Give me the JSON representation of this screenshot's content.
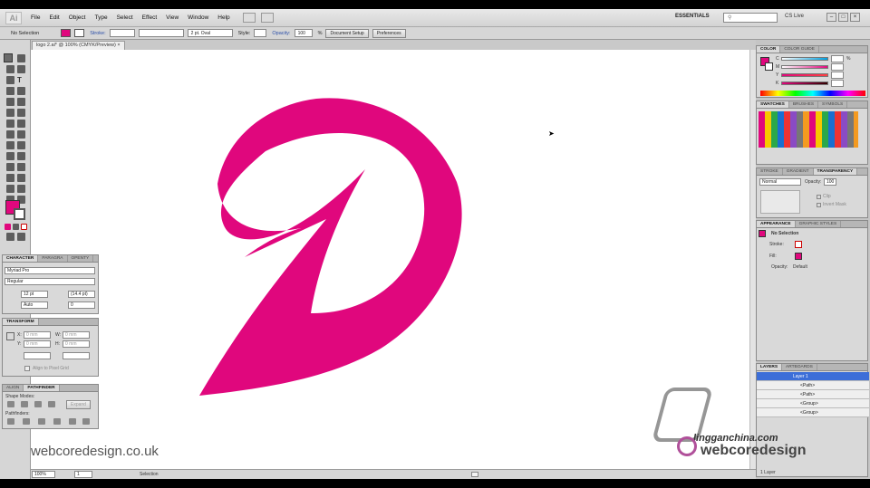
{
  "menubar": {
    "logo": "Ai",
    "items": [
      "File",
      "Edit",
      "Object",
      "Type",
      "Select",
      "Effect",
      "View",
      "Window",
      "Help"
    ],
    "workspace": "ESSENTIALS",
    "cs_live": "CS Live"
  },
  "controlbar": {
    "selection": "No Selection",
    "stroke_label": "Stroke:",
    "brush": "2 pt. Oval",
    "style_label": "Style:",
    "opacity_label": "Opacity:",
    "opacity_value": "100",
    "percent": "%",
    "document_setup": "Document Setup",
    "preferences": "Preferences",
    "fill_color": "#e0077d"
  },
  "document": {
    "tab_title": "logo 2.ai* @ 100% (CMYK/Preview)",
    "logo_color": "#e0077d"
  },
  "statusbar": {
    "zoom": "100%",
    "page": "1",
    "mode": "Selection"
  },
  "character_panel": {
    "tabs": [
      "CHARACTER",
      "PARAGRA",
      "OPENTY"
    ],
    "font": "Myriad Pro",
    "style": "Regular",
    "size": "12 pt",
    "leading": "(14.4 pt)",
    "kerning": "Auto",
    "tracking": "0"
  },
  "transform_panel": {
    "title": "TRANSFORM",
    "x": "0 mm",
    "y": "0 mm",
    "w": "0 mm",
    "h": "0 mm",
    "align_label": "Align to Pixel Grid"
  },
  "pathfinder_panel": {
    "tabs": [
      "ALIGN",
      "PATHFINDER"
    ],
    "shape_modes": "Shape Modes:",
    "expand": "Expand",
    "pathfinders": "Pathfinders:"
  },
  "color_panel": {
    "tabs": [
      "COLOR",
      "COLOR GUIDE"
    ],
    "channels": [
      "C",
      "M",
      "Y",
      "K"
    ],
    "percent": "%"
  },
  "swatches_panel": {
    "tabs": [
      "SWATCHES",
      "BRUSHES",
      "SYMBOLS"
    ]
  },
  "transparency_panel": {
    "tabs": [
      "STROKE",
      "GRADIENT",
      "TRANSPARENCY"
    ],
    "mode": "Normal",
    "opacity_label": "Opacity:",
    "opacity_value": "100",
    "clip": "Clip",
    "invert_mask": "Invert Mask"
  },
  "appearance_panel": {
    "tabs": [
      "APPEARANCE",
      "GRAPHIC STYLES"
    ],
    "header": "No Selection",
    "stroke": "Stroke:",
    "fill": "Fill:",
    "opacity": "Opacity:",
    "opacity_value": "Default"
  },
  "layers_panel": {
    "tabs": [
      "LAYERS",
      "ARTBOARDS"
    ],
    "rows": [
      "Layer 1",
      "<Path>",
      "<Path>",
      "<Group>",
      "<Group>"
    ],
    "footer": "1 Layer"
  },
  "watermarks": {
    "left": "webcoredesign.co.uk",
    "right_top": "lingganchina.com",
    "right_brand": "webcoredesign"
  }
}
